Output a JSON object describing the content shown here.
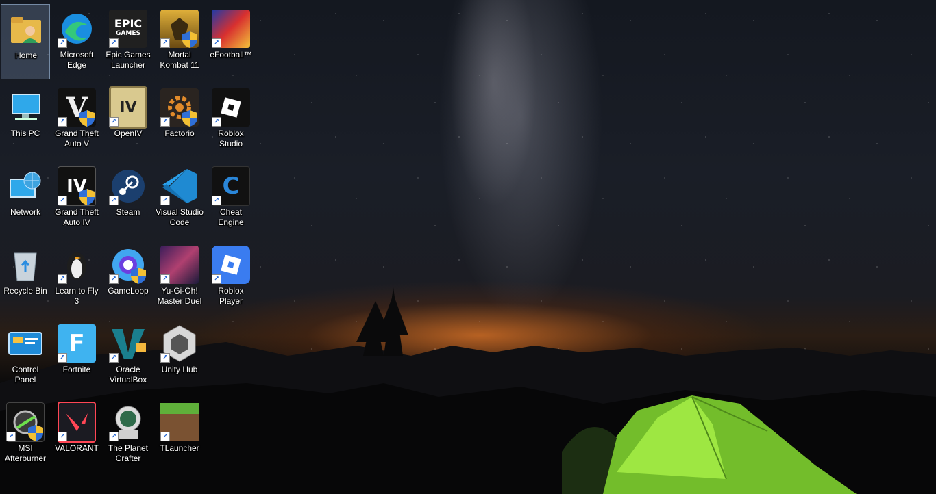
{
  "desktop": {
    "wallpaper": "night-sky-tent-wallpaper",
    "icons": [
      {
        "label": "Home",
        "icon": "home-folder-icon",
        "selected": true
      },
      {
        "label": "Microsoft\nEdge",
        "icon": "edge-icon"
      },
      {
        "label": "Epic Games\nLauncher",
        "icon": "epic-games-icon"
      },
      {
        "label": "Mortal\nKombat 11",
        "icon": "mortal-kombat-icon"
      },
      {
        "label": "eFootball™",
        "icon": "efootball-icon"
      },
      {
        "label": "This PC",
        "icon": "computer-icon"
      },
      {
        "label": "Grand Theft\nAuto V",
        "icon": "gta-v-icon"
      },
      {
        "label": "OpenIV",
        "icon": "openiv-icon"
      },
      {
        "label": "Factorio",
        "icon": "factorio-icon"
      },
      {
        "label": "Roblox\nStudio",
        "icon": "roblox-studio-icon"
      },
      {
        "label": "Network",
        "icon": "network-globe-icon"
      },
      {
        "label": "Grand Theft\nAuto IV",
        "icon": "gta-iv-icon"
      },
      {
        "label": "Steam",
        "icon": "steam-icon"
      },
      {
        "label": "Visual Studio\nCode",
        "icon": "vscode-icon"
      },
      {
        "label": "Cheat Engine",
        "icon": "cheat-engine-icon"
      },
      {
        "label": "Recycle Bin",
        "icon": "recycle-bin-icon"
      },
      {
        "label": "Learn to Fly 3",
        "icon": "penguin-icon"
      },
      {
        "label": "GameLoop",
        "icon": "gameloop-icon"
      },
      {
        "label": "Yu-Gi-Oh!\nMaster Duel",
        "icon": "yugioh-icon"
      },
      {
        "label": "Roblox\nPlayer",
        "icon": "roblox-player-icon"
      },
      {
        "label": "Control\nPanel",
        "icon": "control-panel-icon"
      },
      {
        "label": "Fortnite",
        "icon": "fortnite-icon"
      },
      {
        "label": "Oracle\nVirtualBox",
        "icon": "virtualbox-icon"
      },
      {
        "label": "Unity Hub",
        "icon": "unity-hub-icon"
      },
      {
        "label": "MSI\nAfterburner",
        "icon": "msi-afterburner-icon"
      },
      {
        "label": "VALORANT",
        "icon": "valorant-icon"
      },
      {
        "label": "The Planet\nCrafter",
        "icon": "planet-crafter-icon"
      },
      {
        "label": "TLauncher",
        "icon": "tlauncher-icon"
      }
    ]
  }
}
